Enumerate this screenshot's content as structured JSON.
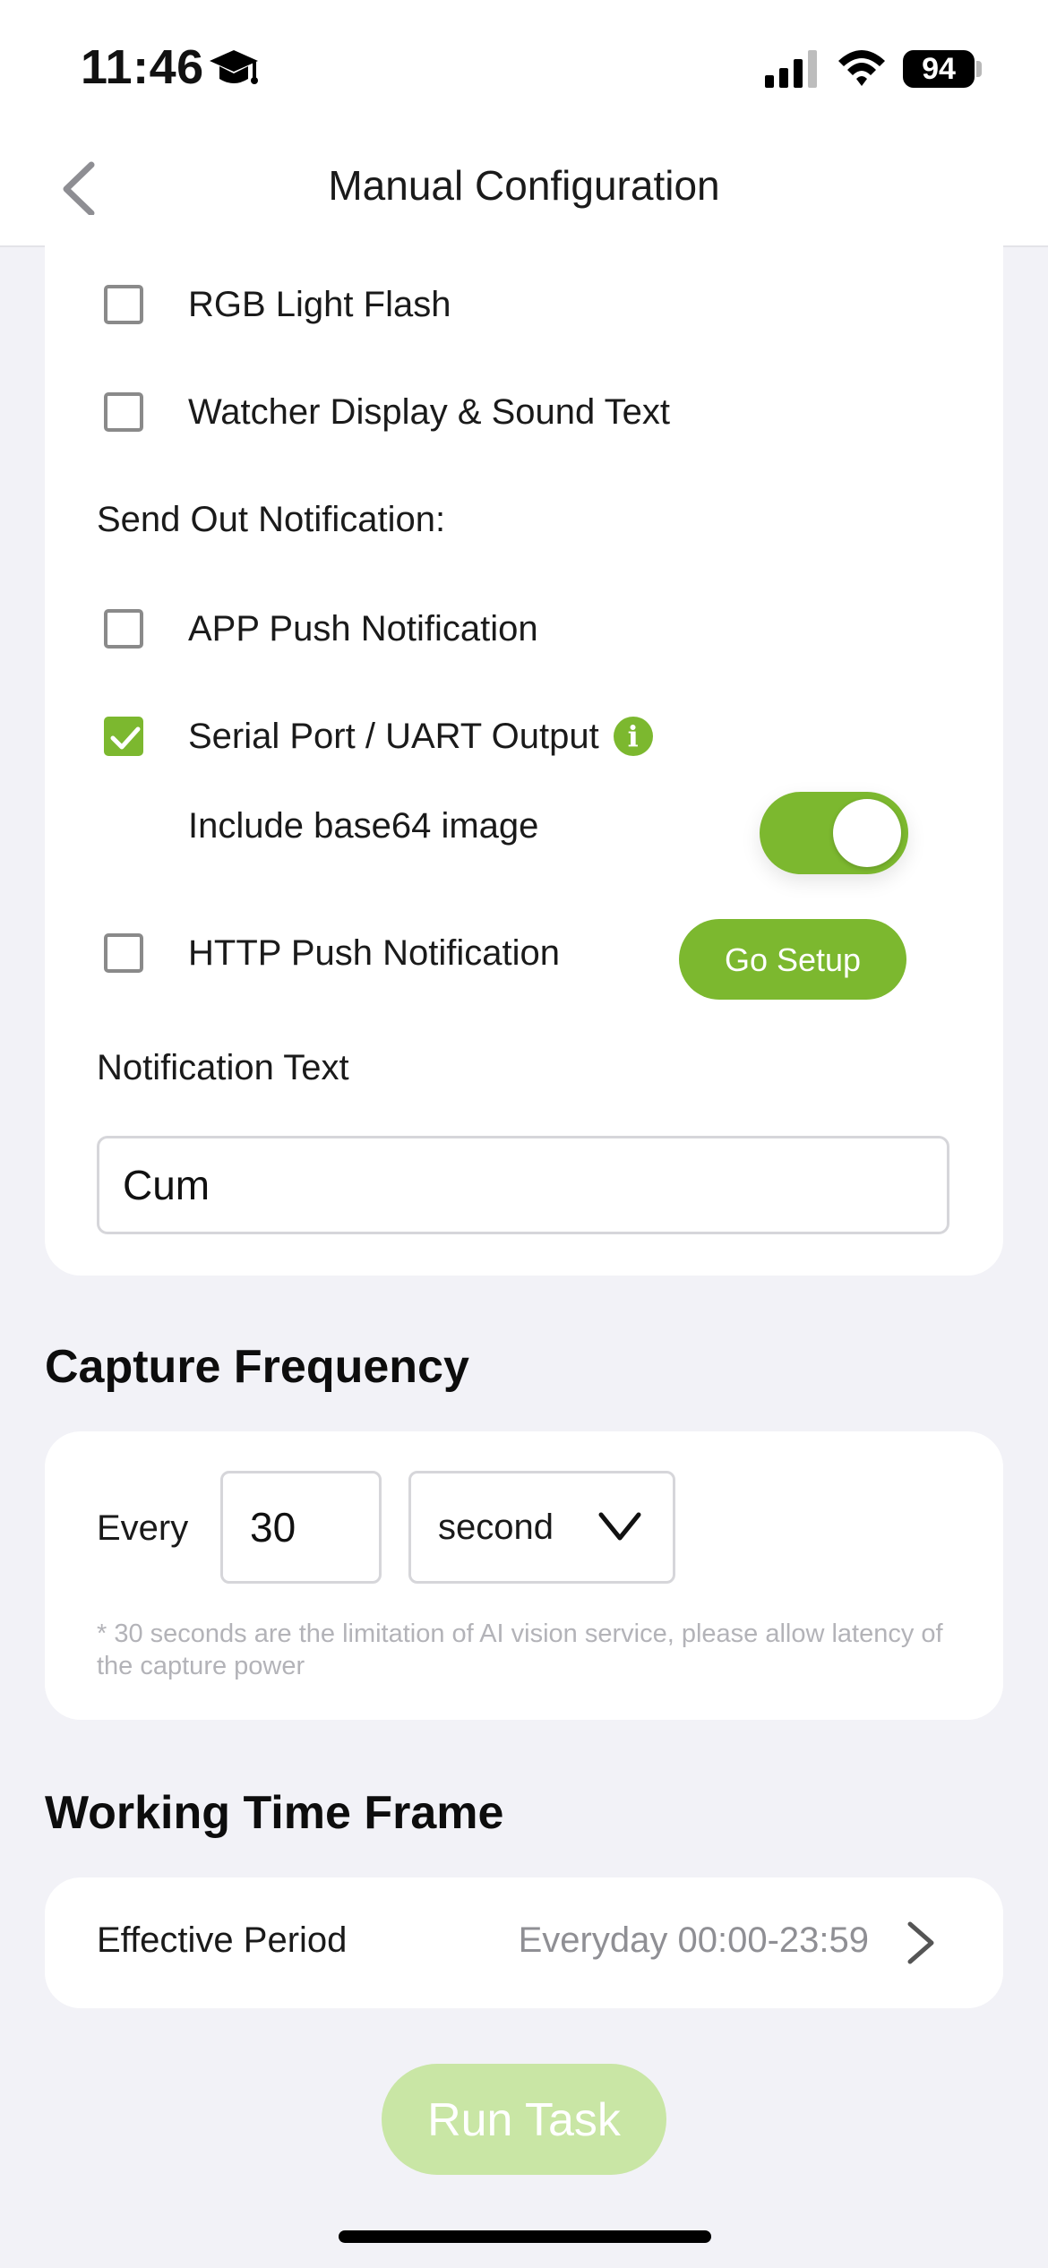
{
  "status_bar": {
    "time": "11:46",
    "battery": "94",
    "icons": [
      "graduation-cap-icon",
      "cellular-signal-icon",
      "wifi-icon",
      "battery-icon"
    ]
  },
  "nav": {
    "title": "Manual Configuration",
    "back_icon": "chevron-left-icon"
  },
  "actions": {
    "rgb_light_flash": {
      "label": "RGB Light Flash",
      "checked": false
    },
    "display_sound_text": {
      "label": "Watcher Display & Sound Text",
      "checked": false
    }
  },
  "notifications": {
    "section_label": "Send Out Notification:",
    "app_push": {
      "label": "APP Push Notification",
      "checked": false
    },
    "serial_uart": {
      "label": "Serial Port / UART Output",
      "checked": true,
      "info_glyph": "i"
    },
    "base64": {
      "label": "Include base64 image",
      "enabled": true
    },
    "http_push": {
      "label": "HTTP Push Notification",
      "checked": false,
      "button_label": "Go Setup"
    },
    "text_label": "Notification Text",
    "text_value": "Cum"
  },
  "capture_frequency": {
    "heading": "Capture Frequency",
    "every_label": "Every",
    "value": "30",
    "unit": "second",
    "note": "* 30 seconds are the limitation of AI vision service, please allow latency of the capture power"
  },
  "working_time": {
    "heading": "Working Time Frame",
    "period_label": "Effective Period",
    "period_value": "Everyday 00:00-23:59"
  },
  "run_button": {
    "label": "Run Task",
    "enabled": false
  },
  "colors": {
    "accent": "#7cb82f",
    "accent_disabled": "#c9e6a5",
    "background": "#f2f2f7"
  }
}
